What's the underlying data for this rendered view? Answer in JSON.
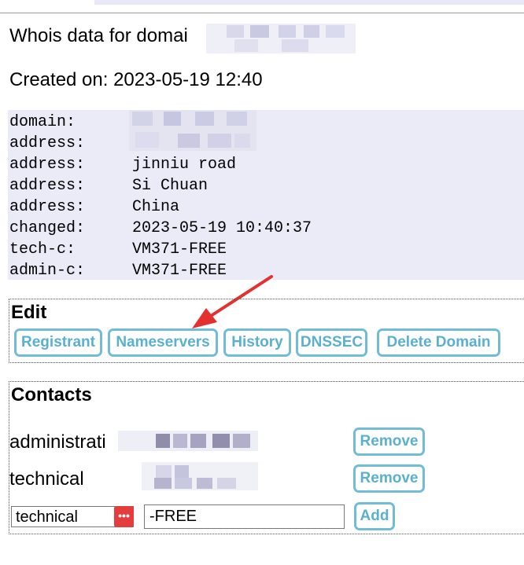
{
  "header": {
    "whois_title": "Whois data for domai",
    "created_on": "Created on: 2023-05-19 12:40"
  },
  "whois": [
    {
      "key": "domain:",
      "value": ""
    },
    {
      "key": "address:",
      "value": ""
    },
    {
      "key": "address:",
      "value": "jinniu road"
    },
    {
      "key": "address:",
      "value": "Si Chuan"
    },
    {
      "key": "address:",
      "value": "China"
    },
    {
      "key": "changed:",
      "value": "2023-05-19 10:40:37"
    },
    {
      "key": "tech-c:",
      "value": "VM371-FREE"
    },
    {
      "key": "admin-c:",
      "value": "VM371-FREE"
    }
  ],
  "edit": {
    "title": "Edit",
    "buttons": {
      "registrant": "Registrant",
      "nameservers": "Nameservers",
      "history": "History",
      "dnssec": "DNSSEC",
      "delete_domain": "Delete Domain"
    }
  },
  "contacts": {
    "title": "Contacts",
    "rows": [
      {
        "label": "administrati",
        "remove": "Remove"
      },
      {
        "label": "technical",
        "remove": "Remove"
      }
    ],
    "new_contact": {
      "type_selected": "technical",
      "handle_value": "-FREE",
      "add": "Add"
    }
  },
  "colors": {
    "button_border": "#73bcd6",
    "button_text": "#5ab0d0",
    "whois_bg": "#ebebf8",
    "annotation_arrow": "#e53030",
    "select_icon_bg": "#e53d3d"
  },
  "icons": {
    "select_icon": "more-dots-icon",
    "annotation": "red-arrow-icon"
  }
}
